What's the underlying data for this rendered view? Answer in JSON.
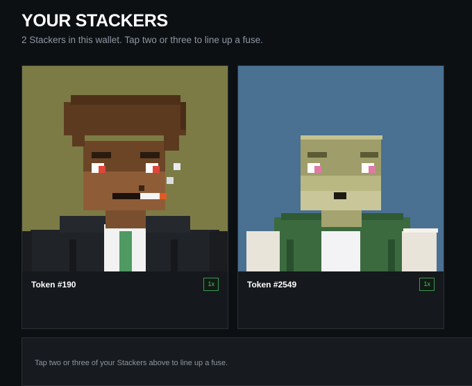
{
  "header": {
    "title": "YOUR STACKERS",
    "subtitle": "2 Stackers in this wallet. Tap two or three to line up a fuse."
  },
  "cards": [
    {
      "token": "Token #190",
      "badge": "1x",
      "background": "#7c7b45"
    },
    {
      "token": "Token #2549",
      "badge": "1x",
      "background": "#4a7092"
    }
  ],
  "fuse_panel": {
    "hint": "Tap two or three of your Stackers above to line up a fuse."
  }
}
